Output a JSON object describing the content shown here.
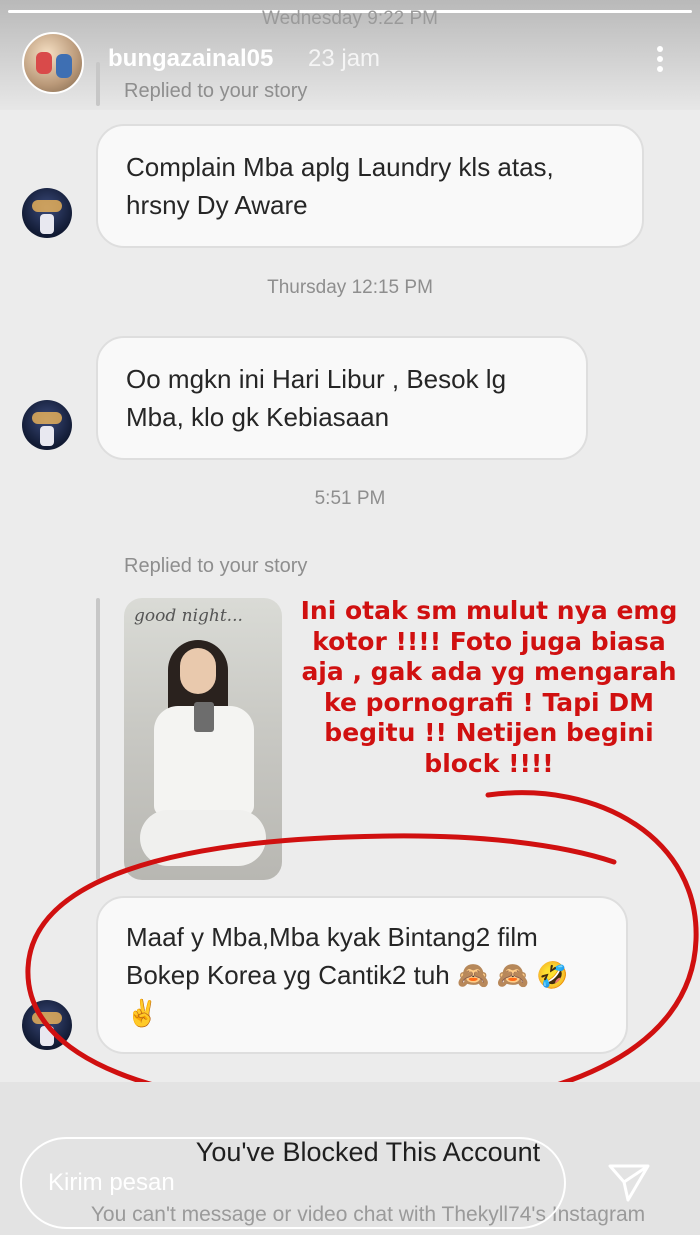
{
  "story": {
    "progress": 1.0
  },
  "top_timestamp": "Wednesday 9:22 PM",
  "header": {
    "username": "bungazainal05",
    "time_ago": "23 jam"
  },
  "thread": {
    "reply_label": "Replied to your story",
    "messages": [
      {
        "text": "Complain Mba aplg Laundry kls atas, hrsny Dy Aware"
      },
      {
        "timestamp": "Thursday 12:15 PM"
      },
      {
        "text": "Oo mgkn ini Hari Libur , Besok lg Mba, klo gk Kebiasaan"
      },
      {
        "timestamp": "5:51 PM"
      },
      {
        "text": "Maaf y Mba,Mba kyak Bintang2 film Bokep Korea yg Cantik2 tuh 🙈 🙈 🤣 ✌️"
      }
    ],
    "story_thumb_text": "good night..."
  },
  "annotation": {
    "text": "Ini otak sm mulut nya emg kotor !!!! Foto juga biasa aja , gak ada yg mengarah ke pornografi ! Tapi DM begitu !! Netijen begini block !!!!",
    "color": "#d01010"
  },
  "blocked": {
    "title": "You've Blocked This Account",
    "subtitle": "You can't message or video chat with Thekyll74's Instagram"
  },
  "reply": {
    "placeholder": "Kirim pesan"
  },
  "colors": {
    "bubble_bg": "#f9f9f9",
    "bubble_border": "#dedede",
    "meta_text": "#8e8e8e"
  }
}
